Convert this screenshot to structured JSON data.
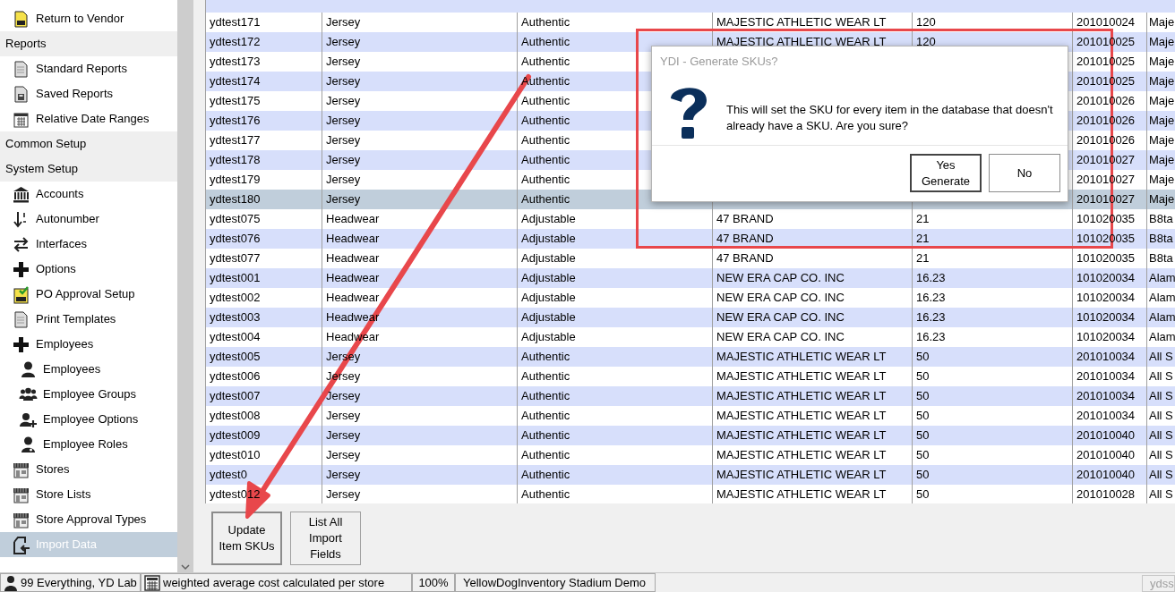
{
  "sidebar": {
    "items": [
      {
        "kind": "item",
        "label": "Return to Vendor",
        "selected": false
      },
      {
        "kind": "header",
        "label": "Reports"
      },
      {
        "kind": "item",
        "label": "Standard Reports",
        "selected": false
      },
      {
        "kind": "item",
        "label": "Saved Reports",
        "selected": false
      },
      {
        "kind": "item",
        "label": "Relative Date Ranges",
        "selected": false
      },
      {
        "kind": "header",
        "label": "Common Setup"
      },
      {
        "kind": "header",
        "label": "System Setup"
      },
      {
        "kind": "item",
        "label": "Accounts",
        "selected": false
      },
      {
        "kind": "item",
        "label": "Autonumber",
        "selected": false
      },
      {
        "kind": "item",
        "label": "Interfaces",
        "selected": false
      },
      {
        "kind": "item",
        "label": "Options",
        "selected": false
      },
      {
        "kind": "item",
        "label": "PO Approval Setup",
        "selected": false
      },
      {
        "kind": "item",
        "label": "Print Templates",
        "selected": false
      },
      {
        "kind": "item",
        "label": "Employees",
        "selected": false,
        "children": [
          {
            "kind": "item",
            "label": "Employees",
            "selected": false
          },
          {
            "kind": "item",
            "label": "Employee Groups",
            "selected": false
          },
          {
            "kind": "item",
            "label": "Employee Options",
            "selected": false
          },
          {
            "kind": "item",
            "label": "Employee Roles",
            "selected": false
          }
        ]
      },
      {
        "kind": "item",
        "label": "Stores",
        "selected": false
      },
      {
        "kind": "item",
        "label": "Store Lists",
        "selected": false
      },
      {
        "kind": "item",
        "label": "Store Approval Types",
        "selected": false
      },
      {
        "kind": "item",
        "label": "Import Data",
        "selected": true
      }
    ]
  },
  "table": {
    "rows": [
      {
        "cells": [
          "ydtest171",
          "Jersey",
          "Authentic",
          "MAJESTIC ATHLETIC WEAR LT",
          "120",
          "201010024",
          "Maje"
        ],
        "selected": false
      },
      {
        "cells": [
          "ydtest172",
          "Jersey",
          "Authentic",
          "MAJESTIC ATHLETIC WEAR LT",
          "120",
          "201010025",
          "Maje"
        ],
        "selected": false
      },
      {
        "cells": [
          "ydtest173",
          "Jersey",
          "Authentic",
          null,
          null,
          "201010025",
          "Maje"
        ],
        "selected": false
      },
      {
        "cells": [
          "ydtest174",
          "Jersey",
          "Authentic",
          null,
          null,
          "201010025",
          "Maje"
        ],
        "selected": false
      },
      {
        "cells": [
          "ydtest175",
          "Jersey",
          "Authentic",
          null,
          null,
          "201010026",
          "Maje"
        ],
        "selected": false
      },
      {
        "cells": [
          "ydtest176",
          "Jersey",
          "Authentic",
          null,
          null,
          "201010026",
          "Maje"
        ],
        "selected": false
      },
      {
        "cells": [
          "ydtest177",
          "Jersey",
          "Authentic",
          null,
          null,
          "201010026",
          "Maje"
        ],
        "selected": false
      },
      {
        "cells": [
          "ydtest178",
          "Jersey",
          "Authentic",
          null,
          null,
          "201010027",
          "Maje"
        ],
        "selected": false
      },
      {
        "cells": [
          "ydtest179",
          "Jersey",
          "Authentic",
          null,
          null,
          "201010027",
          "Maje"
        ],
        "selected": false
      },
      {
        "cells": [
          "ydtest180",
          "Jersey",
          "Authentic",
          null,
          null,
          "201010027",
          "Maje"
        ],
        "selected": true
      },
      {
        "cells": [
          "ydtest075",
          "Headwear",
          "Adjustable",
          "47 BRAND",
          "21",
          "101020035",
          "B8ta"
        ],
        "selected": false
      },
      {
        "cells": [
          "ydtest076",
          "Headwear",
          "Adjustable",
          "47 BRAND",
          "21",
          "101020035",
          "B8ta"
        ],
        "selected": false
      },
      {
        "cells": [
          "ydtest077",
          "Headwear",
          "Adjustable",
          "47 BRAND",
          "21",
          "101020035",
          "B8ta"
        ],
        "selected": false
      },
      {
        "cells": [
          "ydtest001",
          "Headwear",
          "Adjustable",
          "NEW ERA CAP CO. INC",
          "16.23",
          "101020034",
          "Alam"
        ],
        "selected": false
      },
      {
        "cells": [
          "ydtest002",
          "Headwear",
          "Adjustable",
          "NEW ERA CAP CO. INC",
          "16.23",
          "101020034",
          "Alam"
        ],
        "selected": false
      },
      {
        "cells": [
          "ydtest003",
          "Headwear",
          "Adjustable",
          "NEW ERA CAP CO. INC",
          "16.23",
          "101020034",
          "Alam"
        ],
        "selected": false
      },
      {
        "cells": [
          "ydtest004",
          "Headwear",
          "Adjustable",
          "NEW ERA CAP CO. INC",
          "16.23",
          "101020034",
          "Alam"
        ],
        "selected": false
      },
      {
        "cells": [
          "ydtest005",
          "Jersey",
          "Authentic",
          "MAJESTIC ATHLETIC WEAR LT",
          "50",
          "201010034",
          "All S"
        ],
        "selected": false
      },
      {
        "cells": [
          "ydtest006",
          "Jersey",
          "Authentic",
          "MAJESTIC ATHLETIC WEAR LT",
          "50",
          "201010034",
          "All S"
        ],
        "selected": false
      },
      {
        "cells": [
          "ydtest007",
          "Jersey",
          "Authentic",
          "MAJESTIC ATHLETIC WEAR LT",
          "50",
          "201010034",
          "All S"
        ],
        "selected": false
      },
      {
        "cells": [
          "ydtest008",
          "Jersey",
          "Authentic",
          "MAJESTIC ATHLETIC WEAR LT",
          "50",
          "201010034",
          "All S"
        ],
        "selected": false
      },
      {
        "cells": [
          "ydtest009",
          "Jersey",
          "Authentic",
          "MAJESTIC ATHLETIC WEAR LT",
          "50",
          "201010040",
          "All S"
        ],
        "selected": false
      },
      {
        "cells": [
          "ydtest010",
          "Jersey",
          "Authentic",
          "MAJESTIC ATHLETIC WEAR LT",
          "50",
          "201010040",
          "All S"
        ],
        "selected": false
      },
      {
        "cells": [
          "ydtest0",
          "Jersey",
          "Authentic",
          "MAJESTIC ATHLETIC WEAR LT",
          "50",
          "201010040",
          "All S"
        ],
        "selected": false
      },
      {
        "cells": [
          "ydtest012",
          "Jersey",
          "Authentic",
          "MAJESTIC ATHLETIC WEAR LT",
          "50",
          "201010028",
          "All S"
        ],
        "selected": false
      }
    ]
  },
  "buttons": [
    {
      "label": "Update Item SKUs",
      "default": true
    },
    {
      "label": "List All Import Fields",
      "default": false
    }
  ],
  "dialog": {
    "title": "YDI - Generate SKUs?",
    "message": "This will set the SKU for every item in the database that doesn't already have a SKU.  Are you sure?",
    "buttons": [
      {
        "label": "Yes Generate",
        "default": true
      },
      {
        "label": "No",
        "default": false
      }
    ]
  },
  "status_bar": {
    "user": "99 Everything, YD Lab",
    "costing": "weighted average cost calculated per store",
    "zoom": "100%",
    "database": "YellowDogInventory Stadium Demo",
    "field": "ydss"
  }
}
